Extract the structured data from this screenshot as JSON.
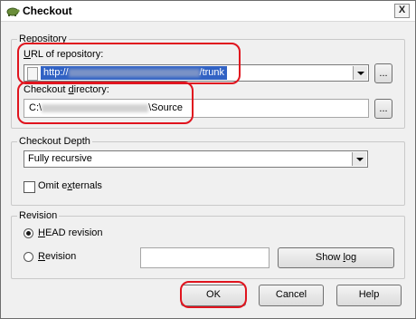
{
  "window": {
    "title": "Checkout",
    "close_label": "X"
  },
  "repository": {
    "legend": "Repository",
    "url_label_pre": "",
    "url_label_accel": "U",
    "url_label_post": "RL of repository:",
    "url_prefix": "http://",
    "url_suffix": "/trunk",
    "browse_label": "..."
  },
  "checkout_directory": {
    "label_pre": "Checkout ",
    "label_accel": "d",
    "label_post": "irectory:",
    "prefix": "C:\\",
    "suffix": "\\Source",
    "browse_label": "..."
  },
  "depth": {
    "legend": "Checkout Depth",
    "selected": "Fully recursive",
    "omit_pre": "Omit e",
    "omit_accel": "x",
    "omit_post": "ternals",
    "omit_checked": false
  },
  "revision": {
    "legend": "Revision",
    "head_accel": "H",
    "head_post": "EAD revision",
    "rev_accel": "R",
    "rev_post": "evision",
    "revision_value": "",
    "show_log_pre": "Show ",
    "show_log_accel": "l",
    "show_log_post": "og",
    "head_selected": true
  },
  "buttons": {
    "ok": "OK",
    "cancel": "Cancel",
    "help": "Help"
  },
  "colors": {
    "highlight": "#e0141e",
    "selection": "#3162c4"
  }
}
